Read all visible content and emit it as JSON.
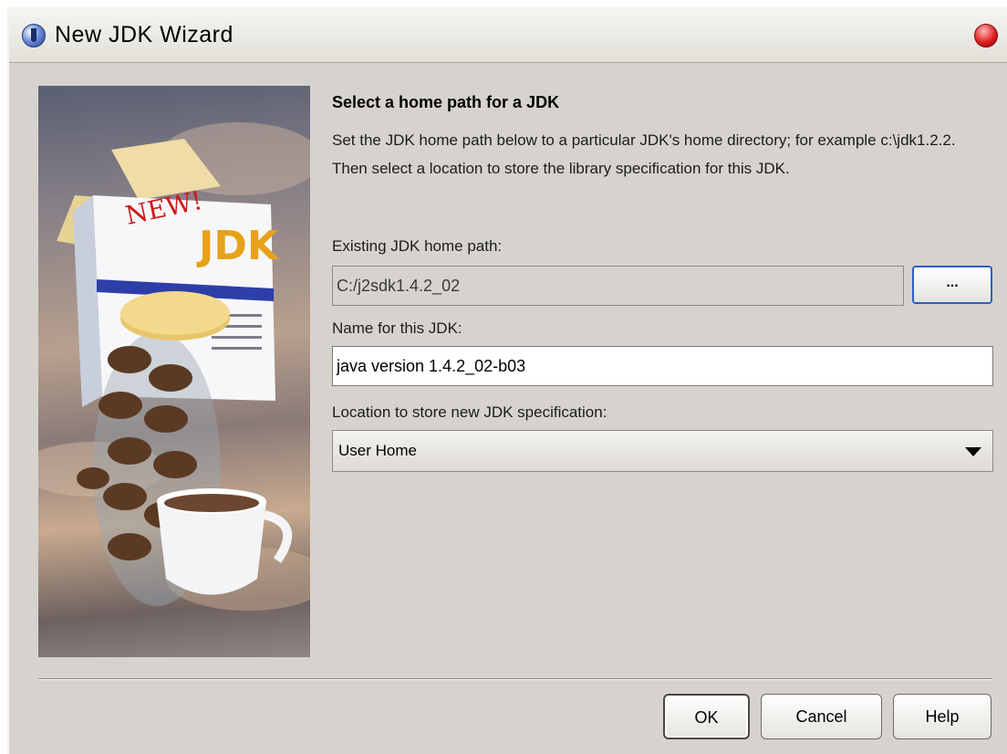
{
  "window": {
    "title": "New JDK Wizard"
  },
  "illustration": {
    "badge": "NEW!",
    "brand": "JDK"
  },
  "content": {
    "heading": "Select a home path for a JDK",
    "description": "Set the JDK home path below to a particular JDK's home directory; for example c:\\jdk1.2.2. Then select a location to store the library specification for this JDK."
  },
  "fields": {
    "home_path": {
      "label": "Existing JDK home path:",
      "value": "C:/j2sdk1.4.2_02",
      "browse_label": "..."
    },
    "name": {
      "label": "Name for this JDK:",
      "value": "java version 1.4.2_02-b03"
    },
    "location": {
      "label": "Location to store new JDK specification:",
      "selected": "User Home"
    }
  },
  "buttons": {
    "ok": "OK",
    "cancel": "Cancel",
    "help": "Help"
  },
  "icons": {
    "app": "java-icon",
    "close": "close-icon",
    "dropdown": "dropdown-arrow-icon"
  }
}
